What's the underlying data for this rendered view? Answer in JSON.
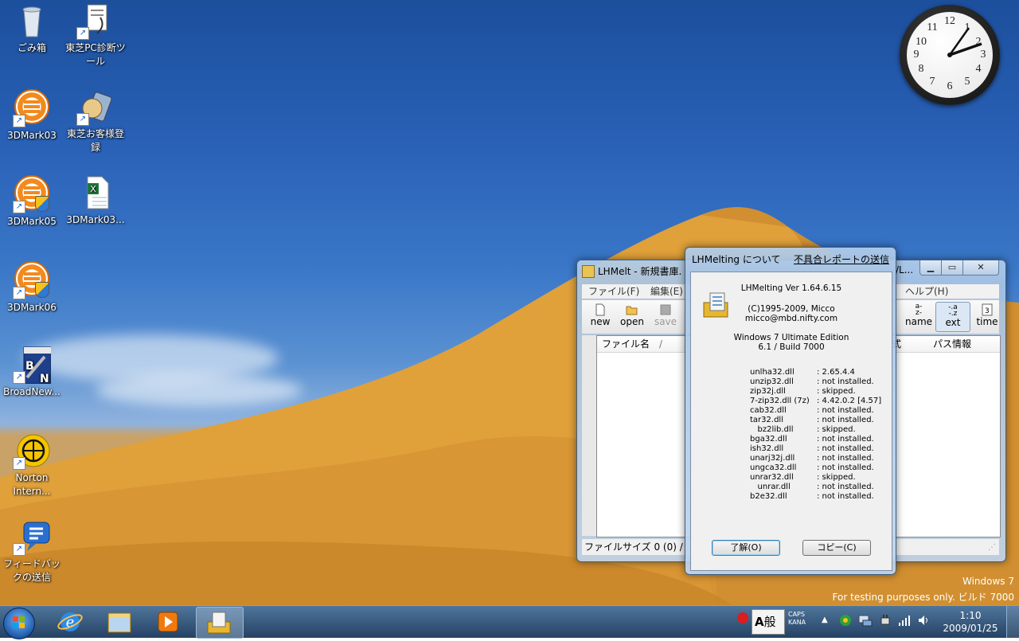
{
  "desktop": {
    "icons": [
      {
        "label": "ごみ箱",
        "icon": "recycle-bin-icon"
      },
      {
        "label": "東芝PC診断ツール",
        "icon": "toshiba-pc-diagnostic-icon"
      },
      {
        "label": "3DMark03",
        "icon": "3dmark-icon"
      },
      {
        "label": "東芝お客様登録",
        "icon": "toshiba-registration-icon"
      },
      {
        "label": "3DMark05",
        "icon": "3dmark-icon"
      },
      {
        "label": "3DMark03...",
        "icon": "excel-file-icon"
      },
      {
        "label": "3DMark06",
        "icon": "3dmark-icon"
      },
      {
        "label": "BroadNew...",
        "icon": "toshiba-broadnews-icon"
      },
      {
        "label": "Norton Intern...",
        "icon": "norton-icon"
      },
      {
        "label": "フィードバックの送信",
        "icon": "feedback-icon"
      }
    ],
    "watermark_line1": "Windows 7",
    "watermark_line2": "For testing purposes only. ビルド 7000"
  },
  "clock_gadget": {
    "numbers": [
      "12",
      "1",
      "2",
      "3",
      "4",
      "5",
      "6",
      "7",
      "8",
      "9",
      "10",
      "11"
    ]
  },
  "main_window": {
    "title": "LHMelt - 新規書庫.",
    "title_suffix": "/L...",
    "menu_left": [
      "ファイル(F)",
      "編集(E)"
    ],
    "menu_right": "ヘルプ(H)",
    "toolbar_left": [
      "new",
      "open",
      "save"
    ],
    "toolbar_right": [
      "name",
      "ext",
      "time"
    ],
    "columns_left": [
      "ファイル名",
      "/"
    ],
    "columns_right": [
      "式",
      "パス情報"
    ],
    "status": "ファイルサイズ 0 (0) /"
  },
  "about_dialog": {
    "title": "LHMelting について",
    "report_link": "不具合レポートの送信",
    "version": "LHMelting Ver 1.64.6.15",
    "copyright": "(C)1995-2009, Micco",
    "email": "micco@mbd.nifty.com",
    "os_name": "Windows 7 Ultimate Edition",
    "os_build": "6.1 / Build 7000",
    "dlls": [
      {
        "name": "unlha32.dll",
        "status": ": 2.65.4.4"
      },
      {
        "name": "unzip32.dll",
        "status": ": not installed."
      },
      {
        "name": "zip32j.dll",
        "status": ": skipped."
      },
      {
        "name": "7-zip32.dll (7z)",
        "status": ": 4.42.0.2 [4.57]"
      },
      {
        "name": "cab32.dll",
        "status": ": not installed."
      },
      {
        "name": "tar32.dll",
        "status": ": not installed."
      },
      {
        "name": "   bz2lib.dll",
        "status": ": skipped."
      },
      {
        "name": "bga32.dll",
        "status": ": not installed."
      },
      {
        "name": "ish32.dll",
        "status": ": not installed."
      },
      {
        "name": "unarj32j.dll",
        "status": ": not installed."
      },
      {
        "name": "ungca32.dll",
        "status": ": not installed."
      },
      {
        "name": "unrar32.dll",
        "status": ": skipped."
      },
      {
        "name": "   unrar.dll",
        "status": ": not installed."
      },
      {
        "name": "b2e32.dll",
        "status": ": not installed."
      }
    ],
    "ok_button": "了解(O)",
    "copy_button": "コピー(C)"
  },
  "taskbar": {
    "ime_mode": "A",
    "ime_kanji": "般",
    "caps": "CAPS",
    "kana": "KANA",
    "time": "1:10",
    "date": "2009/01/25"
  }
}
